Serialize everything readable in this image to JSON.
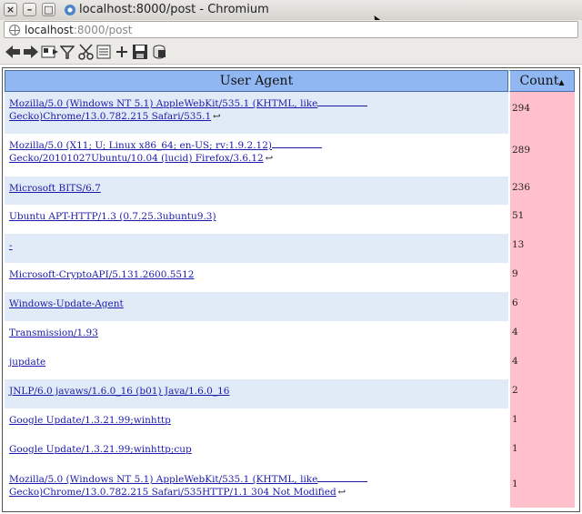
{
  "window": {
    "title": "localhost:8000/post - Chromium",
    "buttons": [
      "×",
      "–",
      "□"
    ]
  },
  "address_bar": {
    "host": "localhost",
    "path": ":8000/post"
  },
  "toolbar": {
    "icons": [
      "back-arrow-icon",
      "forward-arrow-icon",
      "reader-icon",
      "filter-icon",
      "cut-icon",
      "columns-icon",
      "add-icon",
      "save-icon",
      "export-icon"
    ]
  },
  "table": {
    "headers": {
      "user_agent": "User Agent",
      "count": "Count"
    },
    "rows": [
      {
        "line1": "Mozilla/5.0 (Windows NT 5.1) AppleWebKit/535.1 (KHTML, like",
        "line2": "Gecko)Chrome/13.0.782.215 Safari/535.1",
        "count": "294"
      },
      {
        "line1": "Mozilla/5.0 (X11; U; Linux x86_64; en-US; rv:1.9.2.12)",
        "line2": "Gecko/20101027Ubuntu/10.04 (lucid) Firefox/3.6.12",
        "count": "289"
      },
      {
        "line1": "Microsoft BITS/6.7",
        "line2": "",
        "count": "236"
      },
      {
        "line1": "Ubuntu APT-HTTP/1.3 (0.7.25.3ubuntu9.3)",
        "line2": "",
        "count": "51"
      },
      {
        "line1": "-",
        "line2": "",
        "count": "13"
      },
      {
        "line1": "Microsoft-CryptoAPI/5.131.2600.5512",
        "line2": "",
        "count": "9"
      },
      {
        "line1": "Windows-Update-Agent",
        "line2": "",
        "count": "6"
      },
      {
        "line1": "Transmission/1.93",
        "line2": "",
        "count": "4"
      },
      {
        "line1": "jupdate",
        "line2": "",
        "count": "4"
      },
      {
        "line1": "JNLP/6.0 javaws/1.6.0_16 (b01) Java/1.6.0_16",
        "line2": "",
        "count": "2"
      },
      {
        "line1": "Google Update/1.3.21.99;winhttp",
        "line2": "",
        "count": "1"
      },
      {
        "line1": "Google Update/1.3.21.99;winhttp;cup",
        "line2": "",
        "count": "1"
      },
      {
        "line1": "Mozilla/5.0 (Windows NT 5.1) AppleWebKit/535.1 (KHTML, like",
        "line2": "Gecko)Chrome/13.0.782.215 Safari/535HTTP/1.1 304 Not Modified",
        "count": "1"
      }
    ]
  }
}
